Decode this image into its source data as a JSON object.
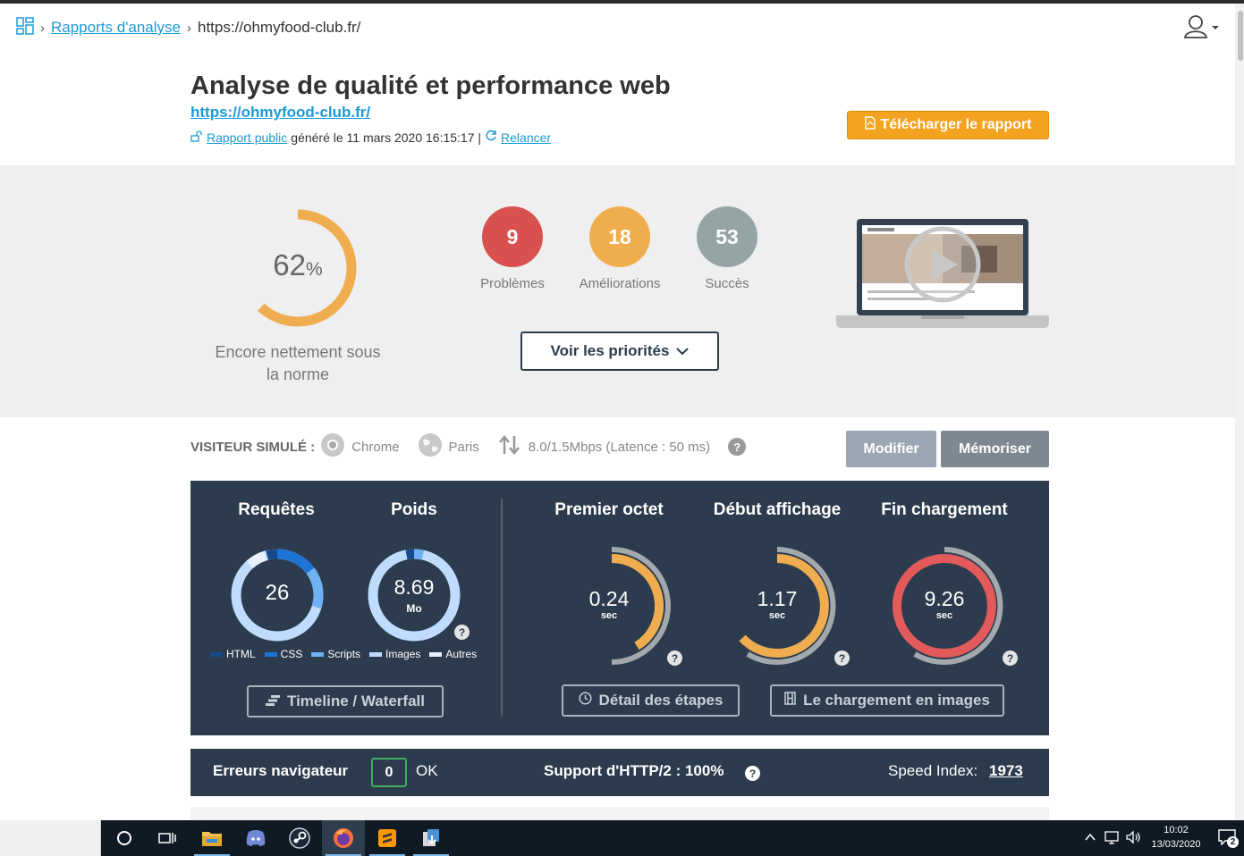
{
  "breadcrumb": {
    "home_icon": "grid-icon",
    "parent": "Rapports d'analyse",
    "current": "https://ohmyfood-club.fr/"
  },
  "header": {
    "title": "Analyse de qualité et performance web",
    "site_url": "https://ohmyfood-club.fr/",
    "public_report": "Rapport public",
    "generated": "généré le 11 mars 2020 16:15:17 |",
    "rerun": "Relancer",
    "download": "Télécharger le rapport"
  },
  "summary": {
    "score": "62",
    "score_unit": "%",
    "score_fraction": 0.62,
    "score_label": "Encore nettement sous la norme",
    "problems": {
      "count": "9",
      "label": "Problèmes",
      "color": "#d9514e"
    },
    "improvements": {
      "count": "18",
      "label": "Améliorations",
      "color": "#f0ad4e"
    },
    "successes": {
      "count": "53",
      "label": "Succès",
      "color": "#95a5a6"
    },
    "priorities_button": "Voir les priorités"
  },
  "simulated_visitor": {
    "label": "VISITEUR SIMULÉ :",
    "browser": "Chrome",
    "location": "Paris",
    "connection": "8.0/1.5Mbps (Latence : 50 ms)",
    "help": "?",
    "modify": "Modifier",
    "save": "Mémoriser"
  },
  "metrics": {
    "requests": {
      "title": "Requêtes",
      "value": "26"
    },
    "weight": {
      "title": "Poids",
      "value": "8.69",
      "unit": "Mo"
    },
    "legend": [
      "HTML",
      "CSS",
      "Scripts",
      "Images",
      "Autres"
    ],
    "ttfb": {
      "title": "Premier octet",
      "value": "0.24",
      "unit": "sec"
    },
    "start_render": {
      "title": "Début affichage",
      "value": "1.17",
      "unit": "sec"
    },
    "fully_loaded": {
      "title": "Fin chargement",
      "value": "9.26",
      "unit": "sec"
    },
    "timeline_button": "Timeline / Waterfall",
    "steps_button": "Détail des étapes",
    "filmstrip_button": "Le chargement en images",
    "help": "?"
  },
  "status_bar": {
    "errors_label": "Erreurs navigateur",
    "errors_count": "0",
    "errors_status": "OK",
    "http2": "Support d'HTTP/2 : 100%",
    "speed_index_label": "Speed Index:",
    "speed_index_value": "1973"
  },
  "taskbar": {
    "time": "10:02",
    "date": "13/03/2020",
    "notifications": "2"
  }
}
